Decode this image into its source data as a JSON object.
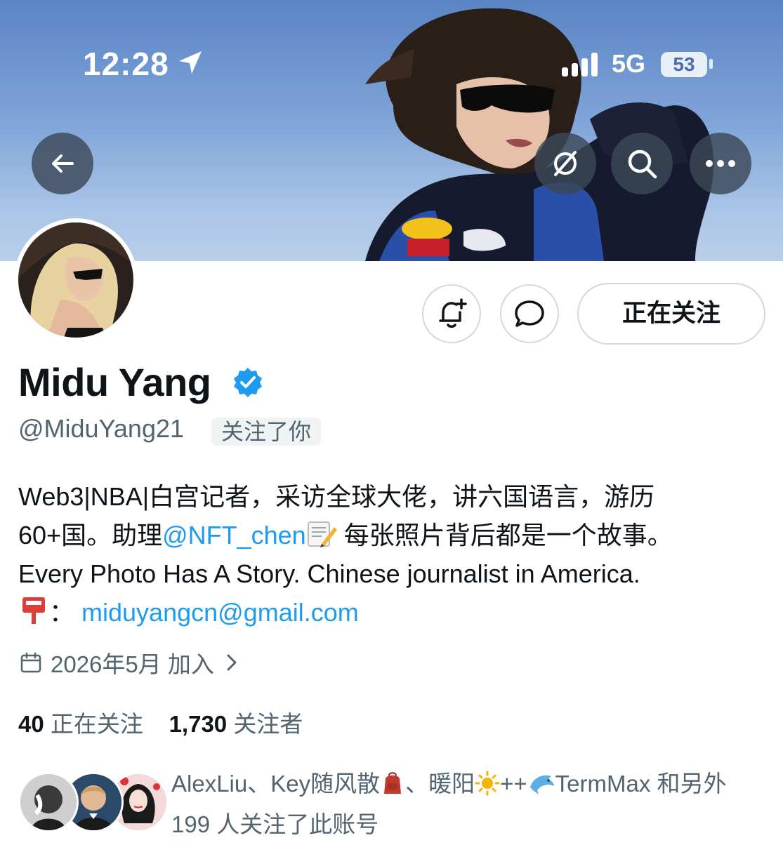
{
  "status_bar": {
    "time": "12:28",
    "network": "5G",
    "battery": "53"
  },
  "nav": {
    "back_icon": "arrow-left-icon",
    "grok_icon": "grok-icon",
    "search_icon": "search-icon",
    "more_icon": "more-dots-icon"
  },
  "profile": {
    "follow_button_label": "正在关注",
    "display_name": "Midu Yang",
    "handle": "@MiduYang21",
    "follows_you_badge": "关注了你",
    "bio": {
      "line1": "Web3|NBA|白宫记者，采访全球大佬，讲六国语言，游历",
      "line2_prefix": "60+国。助理",
      "line2_mention": "@NFT_chen",
      "line2_suffix": " 每张照片背后都是一个故事。",
      "line3": "Every Photo Has A Story. Chinese journalist in America.",
      "line4_sep": "：",
      "email": "miduyangcn@gmail.com"
    },
    "joined": "2026年5月 加入",
    "following_count": "40",
    "following_label": "正在关注",
    "followers_count": "1,730",
    "followers_label": "关注者",
    "followed_by": {
      "line1_names": "AlexLiu、Key随风散",
      "line1_mid": "、暖阳",
      "line1_plus": "++",
      "line1_end": "TermMax 和另外",
      "line2": "199 人关注了此账号"
    }
  },
  "colors": {
    "link": "#1d9bf0",
    "verified": "#1d9bf0",
    "secondary_text": "#536471"
  }
}
